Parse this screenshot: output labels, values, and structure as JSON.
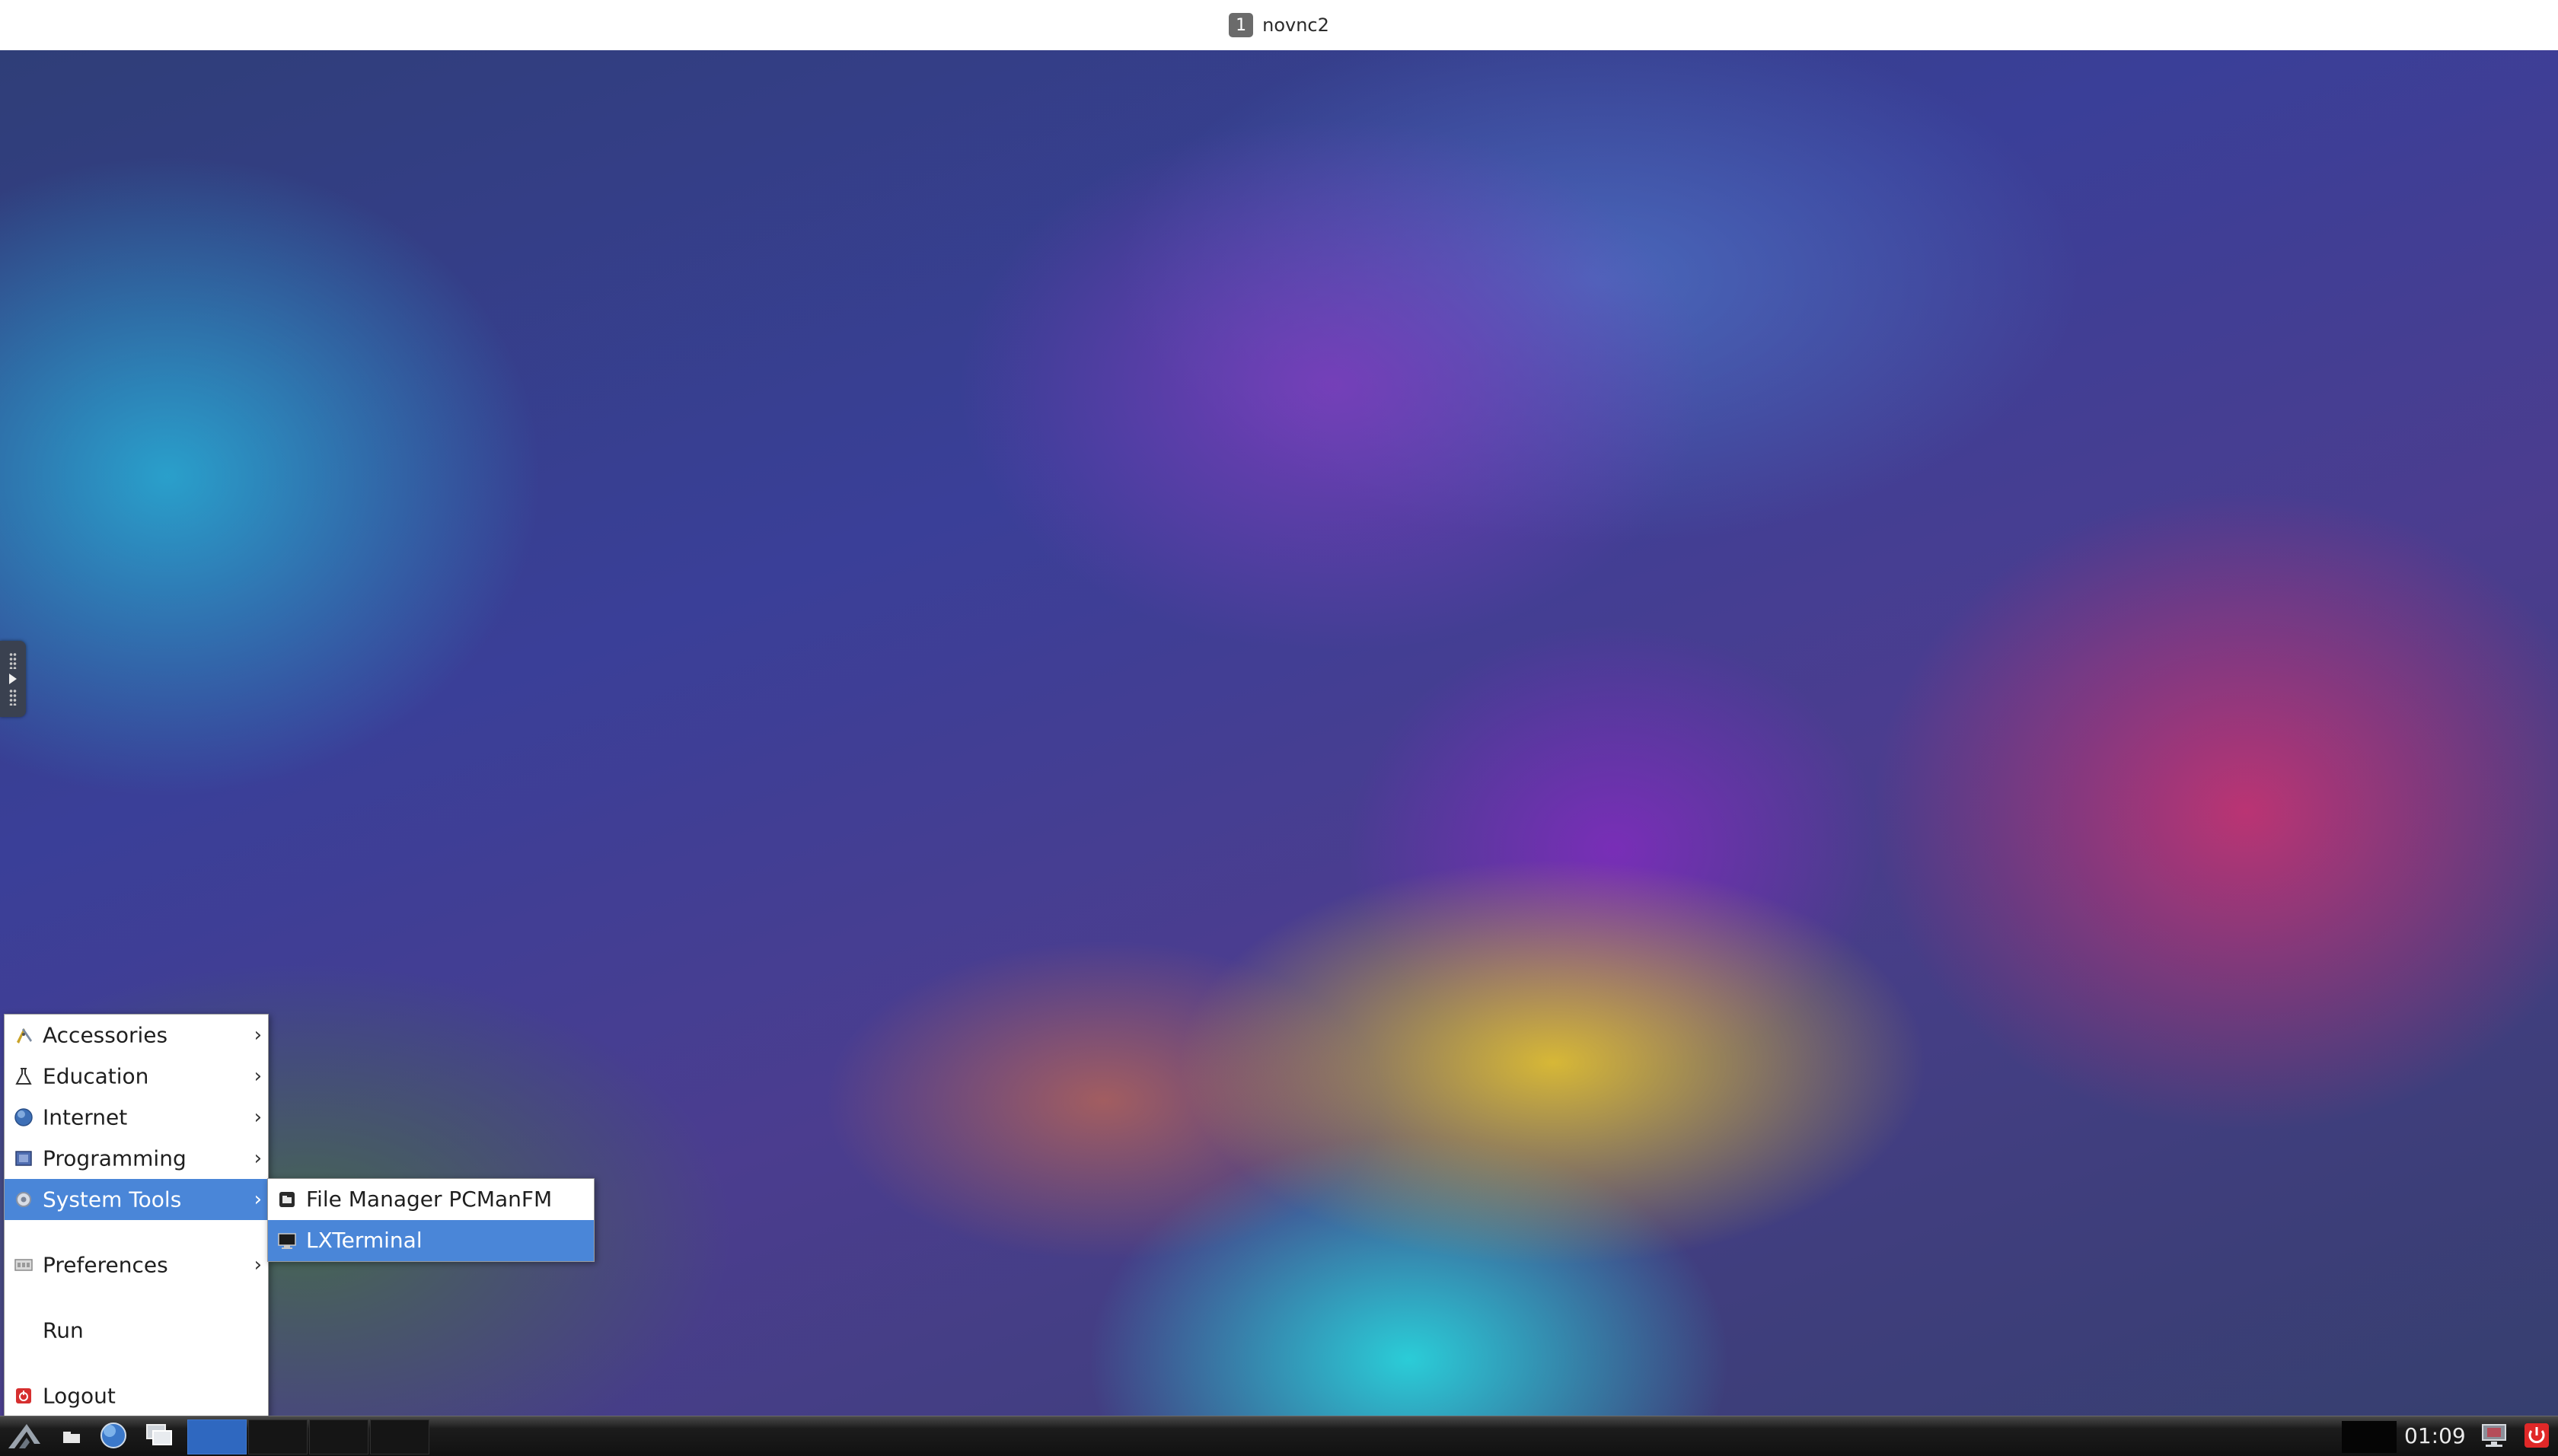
{
  "window": {
    "workspace_number": "1",
    "title": "novnc2"
  },
  "menu": {
    "items": [
      {
        "label": "Accessories",
        "icon": "accessories-icon",
        "has_submenu": true
      },
      {
        "label": "Education",
        "icon": "flask-icon",
        "has_submenu": true
      },
      {
        "label": "Internet",
        "icon": "globe-icon",
        "has_submenu": true
      },
      {
        "label": "Programming",
        "icon": "programming-icon",
        "has_submenu": true
      },
      {
        "label": "System Tools",
        "icon": "system-tools-icon",
        "has_submenu": true,
        "selected": true
      },
      {
        "label": "Preferences",
        "icon": "preferences-icon",
        "has_submenu": true
      },
      {
        "label": "Run",
        "icon": "",
        "has_submenu": false
      },
      {
        "label": "Logout",
        "icon": "logout-icon",
        "has_submenu": false
      }
    ],
    "arrow_glyph": "›"
  },
  "submenu": {
    "items": [
      {
        "label": "File Manager PCManFM",
        "icon": "file-manager-icon"
      },
      {
        "label": "LXTerminal",
        "icon": "terminal-icon",
        "selected": true
      }
    ]
  },
  "taskbar": {
    "clock": "01:09",
    "launchers": [
      "start-menu-icon",
      "show-desktop-icon",
      "web-browser-icon",
      "window-switcher-icon"
    ],
    "tray_icons": [
      "network-icon",
      "power-icon"
    ]
  },
  "colors": {
    "selection": "#4a86d8",
    "power": "#e02828"
  }
}
